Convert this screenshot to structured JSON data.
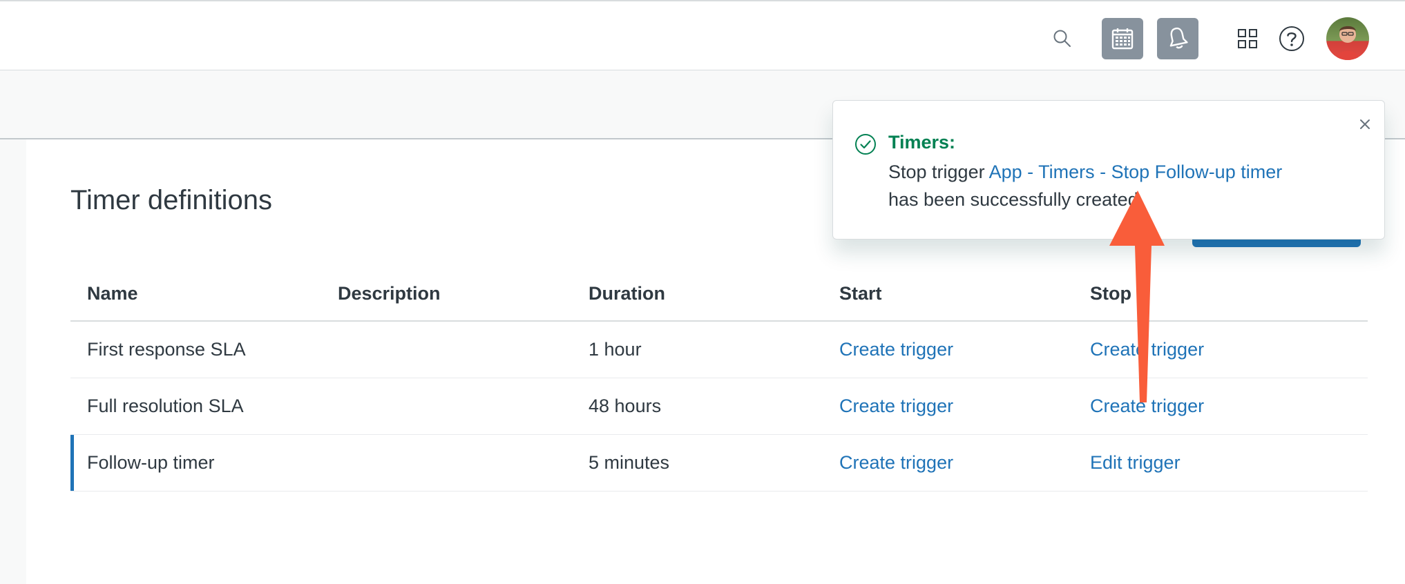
{
  "header": {
    "icons": {
      "search": "search-icon",
      "calendar": "calendar-icon",
      "notifications": "bell-icon",
      "apps": "apps-grid-icon",
      "help": "help-icon",
      "avatar": "user-avatar"
    }
  },
  "page": {
    "title": "Timer definitions"
  },
  "table": {
    "headers": {
      "name": "Name",
      "description": "Description",
      "duration": "Duration",
      "start": "Start",
      "stop": "Stop"
    },
    "rows": [
      {
        "name": "First response SLA",
        "description": "",
        "duration": "1 hour",
        "start": "Create trigger",
        "stop": "Create trigger"
      },
      {
        "name": "Full resolution SLA",
        "description": "",
        "duration": "48 hours",
        "start": "Create trigger",
        "stop": "Create trigger"
      },
      {
        "name": "Follow-up timer",
        "description": "",
        "duration": "5 minutes",
        "start": "Create trigger",
        "stop": "Edit trigger"
      }
    ]
  },
  "toast": {
    "title": "Timers:",
    "prefix": "Stop trigger",
    "link": "App - Timers - Stop Follow-up timer",
    "suffix": "has been successfully created."
  },
  "colors": {
    "accent": "#1f73b7",
    "success": "#038153",
    "annotation_arrow": "#f95d3a"
  }
}
